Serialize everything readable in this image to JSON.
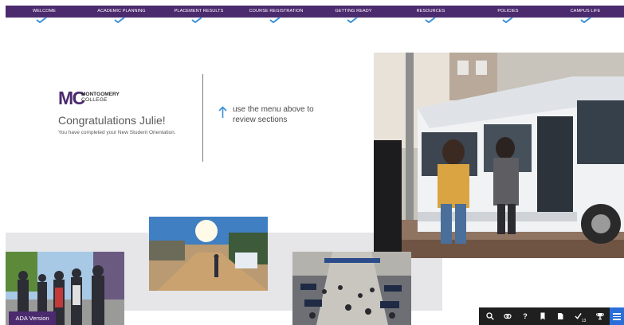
{
  "nav": {
    "items": [
      {
        "label": "WELCOME"
      },
      {
        "label": "ACADEMIC PLANNING"
      },
      {
        "label": "PLACEMENT RESULTS"
      },
      {
        "label": "COURSE REGISTRATION"
      },
      {
        "label": "GETTING READY"
      },
      {
        "label": "RESOURCES"
      },
      {
        "label": "POLICIES"
      },
      {
        "label": "CAMPUS LIFE"
      }
    ],
    "check_icon": "checkmark-icon",
    "bg_color": "#4b2a6e",
    "check_color": "#3a8fd6"
  },
  "logo": {
    "mark": "MC",
    "line1": "MONTGOMERY",
    "line2": "COLLEGE"
  },
  "main": {
    "heading": "Congratulations Julie!",
    "subtext": "You have completed your New Student Orientation.",
    "hint": "use the menu above to review sections",
    "hint_icon": "arrow-up-icon"
  },
  "ada": {
    "label": "ADA Version"
  },
  "toolbar": {
    "tools": [
      {
        "icon": "search-icon"
      },
      {
        "icon": "link-icon"
      },
      {
        "icon": "help-icon",
        "glyph": "?"
      },
      {
        "icon": "bookmark-icon"
      },
      {
        "icon": "notes-icon"
      },
      {
        "icon": "checklist-icon",
        "count": "13"
      },
      {
        "icon": "trophy-icon"
      },
      {
        "icon": "menu-icon"
      }
    ]
  }
}
